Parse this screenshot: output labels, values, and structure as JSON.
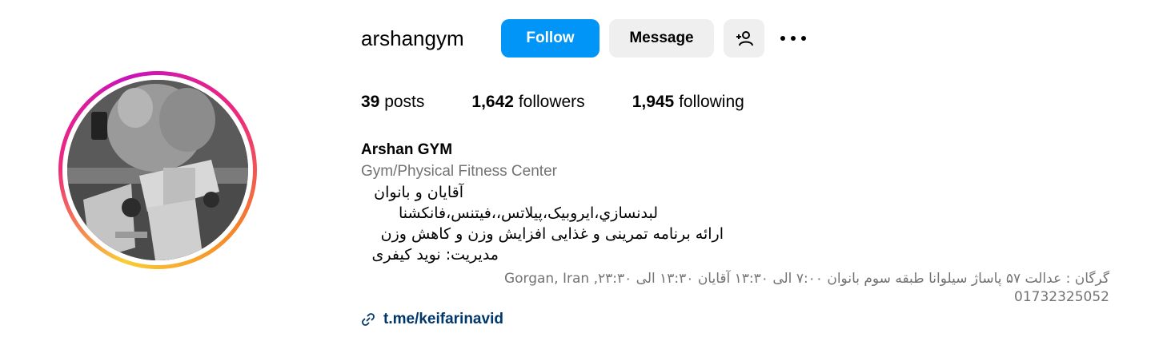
{
  "profile": {
    "username": "arshangym",
    "full_name": "Arshan GYM",
    "category": "Gym/Physical Fitness Center",
    "avatar_icon": "gym-photo-avatar"
  },
  "actions": {
    "follow_label": "Follow",
    "message_label": "Message",
    "add_user_icon": "person-add-icon",
    "more_icon": "more-horizontal-icon"
  },
  "stats": {
    "posts_count": "39",
    "posts_label": "posts",
    "followers_count": "1,642",
    "followers_label": "followers",
    "following_count": "1,945",
    "following_label": "following"
  },
  "bio": {
    "line1": "آقایان و بانوان",
    "line2": "لبدنسازي،ایروبیک،پیلاتس،،فیتنس،فانکشنا",
    "line3": "ارائه برنامه تمرینی و غذایی افزایش وزن و کاهش وزن",
    "line4": "مدیریت: نوید کیفری"
  },
  "address": {
    "line1": "گرگان : عدالت ۵۷ پاساژ سیلوانا طبقه سوم بانوان ۷:۰۰ الی ۱۳:۳۰ آقایان ۱۳:۳۰ الی ۲۳:۳۰, Gorgan, Iran",
    "line2": "01732325052"
  },
  "link": {
    "icon": "link-icon",
    "text": "t.me/keifarinavid"
  },
  "colors": {
    "accent": "#0095f6",
    "secondary_button": "#efefef",
    "muted_text": "#737373",
    "link_text": "#00376b"
  }
}
